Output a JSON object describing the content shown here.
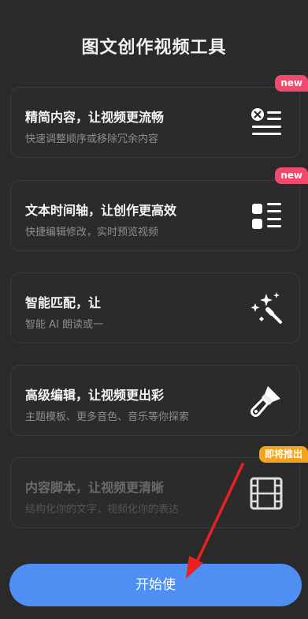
{
  "title": "图文创作视频工具",
  "features": [
    {
      "heading": "精简内容，让视频更流畅",
      "sub": "快速调整顺序或移除冗余内容",
      "badge": "new",
      "icon": "remove-list-icon"
    },
    {
      "heading": "文本时间轴，让创作更高效",
      "sub": "快捷编辑修改，实时预览视频",
      "badge": "new",
      "icon": "checklist-icon"
    },
    {
      "heading": "智能匹配，让",
      "sub": "智能 AI 朗读或一",
      "badge": "",
      "icon": "magic-wand-icon"
    },
    {
      "heading": "高级编辑，让视频更出彩",
      "sub": "主题模板、更多音色、音乐等你探索",
      "badge": "",
      "icon": "paintbrush-icon"
    },
    {
      "heading": "内容脚本，让视频更清晰",
      "sub": "结构化你的文字，视频化你的表达",
      "badge": "即将推出",
      "icon": "film-icon"
    }
  ],
  "start_button": "开始使",
  "colors": {
    "accent": "#4f8ef2",
    "new_badge": "#f14a6c",
    "soon_badge": "#f6a21c",
    "arrow": "#e8231f"
  }
}
